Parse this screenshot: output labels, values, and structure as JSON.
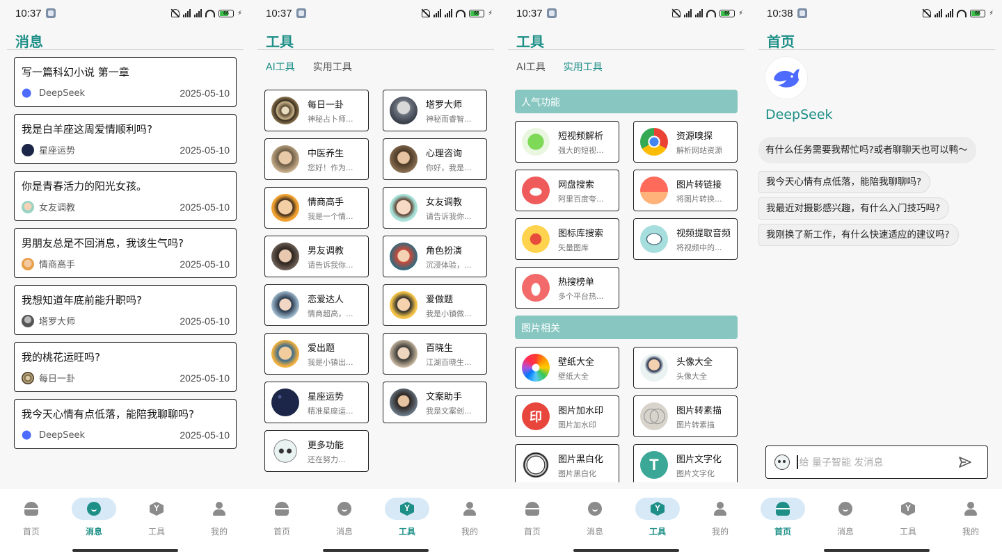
{
  "status_bar": {
    "times": [
      "10:37",
      "10:37",
      "10:37",
      "10:38"
    ],
    "battery": "66",
    "signal1_label": "HD",
    "signal2_label": "HD"
  },
  "nav": {
    "items": [
      "首页",
      "消息",
      "工具",
      "我的"
    ],
    "active_per_screen": [
      "消息",
      "工具",
      "工具",
      "首页"
    ]
  },
  "screen1": {
    "title": "消息",
    "messages": [
      {
        "title": "写一篇科幻小说  第一章",
        "bot": "DeepSeek",
        "date": "2025-05-10"
      },
      {
        "title": "我是白羊座这周爱情顺利吗?",
        "bot": "星座运势",
        "date": "2025-05-10"
      },
      {
        "title": "你是青春活力的阳光女孩。",
        "bot": "女友调教",
        "date": "2025-05-10"
      },
      {
        "title": "男朋友总是不回消息，我该生气吗?",
        "bot": "情商高手",
        "date": "2025-05-10"
      },
      {
        "title": "我想知道年底前能升职吗?",
        "bot": "塔罗大师",
        "date": "2025-05-10"
      },
      {
        "title": "我的桃花运旺吗?",
        "bot": "每日一卦",
        "date": "2025-05-10"
      },
      {
        "title": "我今天心情有点低落，能陪我聊聊吗?",
        "bot": "DeepSeek",
        "date": "2025-05-10"
      }
    ]
  },
  "screen2": {
    "title": "工具",
    "tabs": [
      "AI工具",
      "实用工具"
    ],
    "active_tab": "AI工具",
    "tools": [
      {
        "name": "每日一卦",
        "desc": "神秘占卜师..."
      },
      {
        "name": "塔罗大师",
        "desc": "神秘而睿智..."
      },
      {
        "name": "中医养生",
        "desc": "您好！作为..."
      },
      {
        "name": "心理咨询",
        "desc": "你好，我是..."
      },
      {
        "name": "情商高手",
        "desc": "我是一个情..."
      },
      {
        "name": "女友调教",
        "desc": "请告诉我你..."
      },
      {
        "name": "男友调教",
        "desc": "请告诉我你..."
      },
      {
        "name": "角色扮演",
        "desc": "沉浸体验，..."
      },
      {
        "name": "恋爱达人",
        "desc": "情商超高，..."
      },
      {
        "name": "爱做题",
        "desc": "我是小镇做..."
      },
      {
        "name": "爱出题",
        "desc": "我是小镇出..."
      },
      {
        "name": "百晓生",
        "desc": "江湖百晓生..."
      },
      {
        "name": "星座运势",
        "desc": "精准星座运..."
      },
      {
        "name": "文案助手",
        "desc": "我是文案创..."
      },
      {
        "name": "更多功能",
        "desc": "还在努力..."
      }
    ]
  },
  "screen3": {
    "title": "工具",
    "tabs": [
      "AI工具",
      "实用工具"
    ],
    "active_tab": "实用工具",
    "sections": [
      {
        "title": "人气功能",
        "tools": [
          {
            "name": "短视频解析",
            "desc": "强大的短视..."
          },
          {
            "name": "资源嗅探",
            "desc": "解析网站资源"
          },
          {
            "name": "网盘搜索",
            "desc": "阿里百度夸..."
          },
          {
            "name": "图片转链接",
            "desc": "将图片转换..."
          },
          {
            "name": "图标库搜索",
            "desc": "矢量图库"
          },
          {
            "name": "视频提取音频",
            "desc": "将视频中的..."
          },
          {
            "name": "热搜榜单",
            "desc": "多个平台热..."
          }
        ]
      },
      {
        "title": "图片相关",
        "tools": [
          {
            "name": "壁纸大全",
            "desc": "壁纸大全"
          },
          {
            "name": "头像大全",
            "desc": "头像大全"
          },
          {
            "name": "图片加水印",
            "desc": "图片加水印"
          },
          {
            "name": "图片转素描",
            "desc": "图片转素描"
          },
          {
            "name": "图片黑白化",
            "desc": "图片黑白化"
          },
          {
            "name": "图片文字化",
            "desc": "图片文字化"
          }
        ]
      }
    ]
  },
  "screen4": {
    "title": "首页",
    "brand": "DeepSeek",
    "greeting": "有什么任务需要我帮忙吗?或者聊聊天也可以鸭～",
    "suggestions": [
      "我今天心情有点低落，能陪我聊聊吗?",
      "我最近对摄影感兴趣，有什么入门技巧吗?",
      "我刚换了新工作，有什么快速适应的建议吗?"
    ],
    "input_placeholder": "给 量子智能 发消息"
  },
  "colors": {
    "accent": "#1d8f87",
    "section_bg": "#88c7c1",
    "nav_active_pill": "#d7e9f7"
  }
}
